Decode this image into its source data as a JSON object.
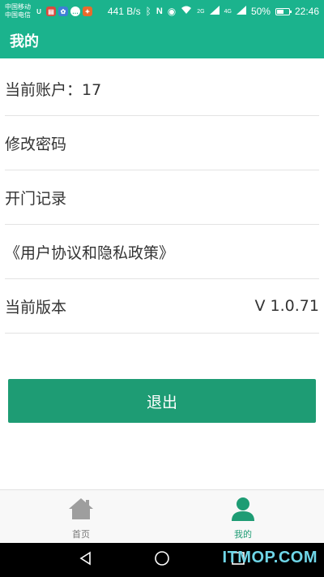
{
  "status_bar": {
    "carrier_1": "中国移动",
    "carrier_2": "中国电信",
    "net_speed": "441 B/s",
    "signal_1": "2G",
    "signal_2": "4G",
    "battery": "50%",
    "time": "22:46",
    "icons": [
      "u-icon",
      "news-icon",
      "app-icon",
      "chat-icon",
      "app-icon-2",
      "bluetooth-icon",
      "nfc-icon",
      "eye-icon",
      "wifi-icon",
      "signal-icon",
      "battery-icon"
    ]
  },
  "app_bar": {
    "title": "我的"
  },
  "menu": {
    "items": [
      {
        "label": "当前账户：17",
        "value": ""
      },
      {
        "label": "修改密码",
        "value": ""
      },
      {
        "label": "开门记录",
        "value": ""
      },
      {
        "label": "《用户协议和隐私政策》",
        "value": ""
      },
      {
        "label": "当前版本",
        "value": "V 1.0.71"
      }
    ]
  },
  "logout": {
    "label": "退出"
  },
  "tabs": [
    {
      "label": "首页",
      "icon": "home-icon",
      "active": false
    },
    {
      "label": "我的",
      "icon": "user-icon",
      "active": true
    }
  ],
  "colors": {
    "primary": "#1bb38d",
    "button": "#1e9c74",
    "tab_inactive": "#9e9e9e"
  },
  "watermark": "ITMOP.COM"
}
